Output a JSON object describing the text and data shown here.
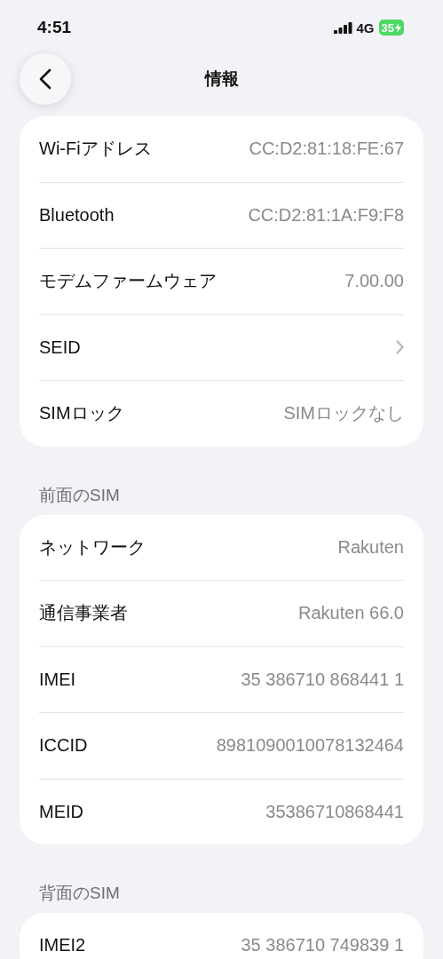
{
  "status_bar": {
    "time": "4:51",
    "network": "4G",
    "battery": "35"
  },
  "nav": {
    "title": "情報"
  },
  "sections": [
    {
      "rows": [
        {
          "kind": "value",
          "label": "Wi-Fiアドレス",
          "value": "CC:D2:81:18:FE:67"
        },
        {
          "kind": "value",
          "label": "Bluetooth",
          "value": "CC:D2:81:1A:F9:F8"
        },
        {
          "kind": "value",
          "label": "モデムファームウェア",
          "value": "7.00.00"
        },
        {
          "kind": "link",
          "label": "SEID"
        },
        {
          "kind": "value",
          "label": "SIMロック",
          "value": "SIMロックなし"
        }
      ]
    },
    {
      "header": "前面のSIM",
      "rows": [
        {
          "kind": "value",
          "label": "ネットワーク",
          "value": "Rakuten"
        },
        {
          "kind": "value",
          "label": "通信事業者",
          "value": "Rakuten 66.0"
        },
        {
          "kind": "value",
          "label": "IMEI",
          "value": "35 386710 868441 1"
        },
        {
          "kind": "value",
          "label": "ICCID",
          "value": "8981090010078132464"
        },
        {
          "kind": "value",
          "label": "MEID",
          "value": "35386710868441"
        }
      ]
    },
    {
      "header": "背面のSIM",
      "rows": [
        {
          "kind": "value",
          "label": "IMEI2",
          "value": "35 386710 749839 1"
        }
      ]
    }
  ]
}
